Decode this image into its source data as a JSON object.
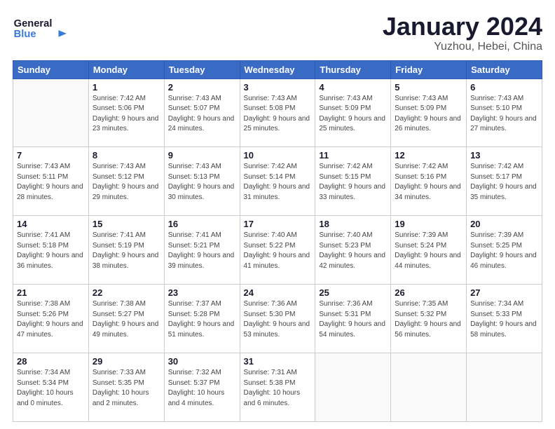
{
  "header": {
    "logo_general": "General",
    "logo_blue": "Blue",
    "month_title": "January 2024",
    "subtitle": "Yuzhou, Hebei, China"
  },
  "days_of_week": [
    "Sunday",
    "Monday",
    "Tuesday",
    "Wednesday",
    "Thursday",
    "Friday",
    "Saturday"
  ],
  "weeks": [
    [
      {
        "day": "",
        "sunrise": "",
        "sunset": "",
        "daylight": ""
      },
      {
        "day": "1",
        "sunrise": "Sunrise: 7:42 AM",
        "sunset": "Sunset: 5:06 PM",
        "daylight": "Daylight: 9 hours and 23 minutes."
      },
      {
        "day": "2",
        "sunrise": "Sunrise: 7:43 AM",
        "sunset": "Sunset: 5:07 PM",
        "daylight": "Daylight: 9 hours and 24 minutes."
      },
      {
        "day": "3",
        "sunrise": "Sunrise: 7:43 AM",
        "sunset": "Sunset: 5:08 PM",
        "daylight": "Daylight: 9 hours and 25 minutes."
      },
      {
        "day": "4",
        "sunrise": "Sunrise: 7:43 AM",
        "sunset": "Sunset: 5:09 PM",
        "daylight": "Daylight: 9 hours and 25 minutes."
      },
      {
        "day": "5",
        "sunrise": "Sunrise: 7:43 AM",
        "sunset": "Sunset: 5:09 PM",
        "daylight": "Daylight: 9 hours and 26 minutes."
      },
      {
        "day": "6",
        "sunrise": "Sunrise: 7:43 AM",
        "sunset": "Sunset: 5:10 PM",
        "daylight": "Daylight: 9 hours and 27 minutes."
      }
    ],
    [
      {
        "day": "7",
        "sunrise": "Sunrise: 7:43 AM",
        "sunset": "Sunset: 5:11 PM",
        "daylight": "Daylight: 9 hours and 28 minutes."
      },
      {
        "day": "8",
        "sunrise": "Sunrise: 7:43 AM",
        "sunset": "Sunset: 5:12 PM",
        "daylight": "Daylight: 9 hours and 29 minutes."
      },
      {
        "day": "9",
        "sunrise": "Sunrise: 7:43 AM",
        "sunset": "Sunset: 5:13 PM",
        "daylight": "Daylight: 9 hours and 30 minutes."
      },
      {
        "day": "10",
        "sunrise": "Sunrise: 7:42 AM",
        "sunset": "Sunset: 5:14 PM",
        "daylight": "Daylight: 9 hours and 31 minutes."
      },
      {
        "day": "11",
        "sunrise": "Sunrise: 7:42 AM",
        "sunset": "Sunset: 5:15 PM",
        "daylight": "Daylight: 9 hours and 33 minutes."
      },
      {
        "day": "12",
        "sunrise": "Sunrise: 7:42 AM",
        "sunset": "Sunset: 5:16 PM",
        "daylight": "Daylight: 9 hours and 34 minutes."
      },
      {
        "day": "13",
        "sunrise": "Sunrise: 7:42 AM",
        "sunset": "Sunset: 5:17 PM",
        "daylight": "Daylight: 9 hours and 35 minutes."
      }
    ],
    [
      {
        "day": "14",
        "sunrise": "Sunrise: 7:41 AM",
        "sunset": "Sunset: 5:18 PM",
        "daylight": "Daylight: 9 hours and 36 minutes."
      },
      {
        "day": "15",
        "sunrise": "Sunrise: 7:41 AM",
        "sunset": "Sunset: 5:19 PM",
        "daylight": "Daylight: 9 hours and 38 minutes."
      },
      {
        "day": "16",
        "sunrise": "Sunrise: 7:41 AM",
        "sunset": "Sunset: 5:21 PM",
        "daylight": "Daylight: 9 hours and 39 minutes."
      },
      {
        "day": "17",
        "sunrise": "Sunrise: 7:40 AM",
        "sunset": "Sunset: 5:22 PM",
        "daylight": "Daylight: 9 hours and 41 minutes."
      },
      {
        "day": "18",
        "sunrise": "Sunrise: 7:40 AM",
        "sunset": "Sunset: 5:23 PM",
        "daylight": "Daylight: 9 hours and 42 minutes."
      },
      {
        "day": "19",
        "sunrise": "Sunrise: 7:39 AM",
        "sunset": "Sunset: 5:24 PM",
        "daylight": "Daylight: 9 hours and 44 minutes."
      },
      {
        "day": "20",
        "sunrise": "Sunrise: 7:39 AM",
        "sunset": "Sunset: 5:25 PM",
        "daylight": "Daylight: 9 hours and 46 minutes."
      }
    ],
    [
      {
        "day": "21",
        "sunrise": "Sunrise: 7:38 AM",
        "sunset": "Sunset: 5:26 PM",
        "daylight": "Daylight: 9 hours and 47 minutes."
      },
      {
        "day": "22",
        "sunrise": "Sunrise: 7:38 AM",
        "sunset": "Sunset: 5:27 PM",
        "daylight": "Daylight: 9 hours and 49 minutes."
      },
      {
        "day": "23",
        "sunrise": "Sunrise: 7:37 AM",
        "sunset": "Sunset: 5:28 PM",
        "daylight": "Daylight: 9 hours and 51 minutes."
      },
      {
        "day": "24",
        "sunrise": "Sunrise: 7:36 AM",
        "sunset": "Sunset: 5:30 PM",
        "daylight": "Daylight: 9 hours and 53 minutes."
      },
      {
        "day": "25",
        "sunrise": "Sunrise: 7:36 AM",
        "sunset": "Sunset: 5:31 PM",
        "daylight": "Daylight: 9 hours and 54 minutes."
      },
      {
        "day": "26",
        "sunrise": "Sunrise: 7:35 AM",
        "sunset": "Sunset: 5:32 PM",
        "daylight": "Daylight: 9 hours and 56 minutes."
      },
      {
        "day": "27",
        "sunrise": "Sunrise: 7:34 AM",
        "sunset": "Sunset: 5:33 PM",
        "daylight": "Daylight: 9 hours and 58 minutes."
      }
    ],
    [
      {
        "day": "28",
        "sunrise": "Sunrise: 7:34 AM",
        "sunset": "Sunset: 5:34 PM",
        "daylight": "Daylight: 10 hours and 0 minutes."
      },
      {
        "day": "29",
        "sunrise": "Sunrise: 7:33 AM",
        "sunset": "Sunset: 5:35 PM",
        "daylight": "Daylight: 10 hours and 2 minutes."
      },
      {
        "day": "30",
        "sunrise": "Sunrise: 7:32 AM",
        "sunset": "Sunset: 5:37 PM",
        "daylight": "Daylight: 10 hours and 4 minutes."
      },
      {
        "day": "31",
        "sunrise": "Sunrise: 7:31 AM",
        "sunset": "Sunset: 5:38 PM",
        "daylight": "Daylight: 10 hours and 6 minutes."
      },
      {
        "day": "",
        "sunrise": "",
        "sunset": "",
        "daylight": ""
      },
      {
        "day": "",
        "sunrise": "",
        "sunset": "",
        "daylight": ""
      },
      {
        "day": "",
        "sunrise": "",
        "sunset": "",
        "daylight": ""
      }
    ]
  ]
}
